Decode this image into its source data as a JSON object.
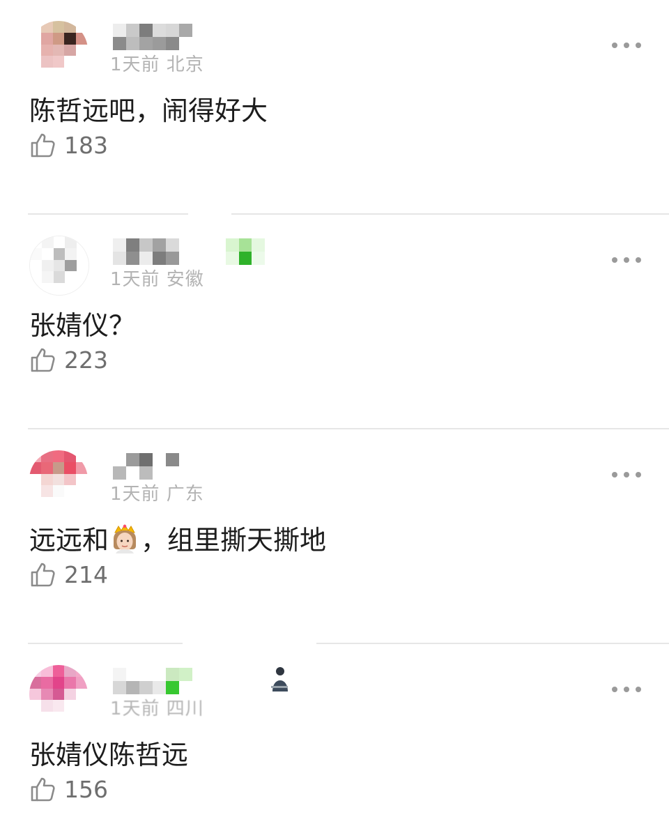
{
  "comments": [
    {
      "meta": "1天前 北京",
      "text": "陈哲远吧，闹得好大",
      "likes": "183",
      "avatar_colors": [
        "#fff",
        "#e7c9b6",
        "#d6c19f",
        "#d2b79c",
        "#fff",
        "#fff",
        "#e0a6a2",
        "#cf9a85",
        "#3a2520",
        "#d49187",
        "#fff",
        "#e6b2ae",
        "#e3b8b4",
        "#d6a6a4",
        "#fff",
        "#fff",
        "#ecc3c3",
        "#f0c8c8",
        "#fff",
        "#fff",
        "#fff",
        "#fff",
        "#fff",
        "#fff",
        "#fff"
      ],
      "name_colors": [
        "#ededed",
        "#8b8b8b",
        "#c9c9c9",
        "#bdbdbd",
        "#7d7d7d",
        "#a3a3a3",
        "#dcdcdc",
        "#9b9b9b",
        "#d7d7d7",
        "#8a8a8a",
        "#a9a9a9"
      ]
    },
    {
      "meta": "1天前 安徽",
      "text": "张婧仪？",
      "likes": "223",
      "avatar_colors": [
        "#fff",
        "#f4f4f4",
        "#ffffff",
        "#eeeeee",
        "#fff",
        "#fafafa",
        "#ffffff",
        "#bdbdbd",
        "#f3f3f3",
        "#fff",
        "#fff",
        "#f0f0f0",
        "#e6e6e6",
        "#9e9e9e",
        "#fff",
        "#fff",
        "#f5f5f5",
        "#dadada",
        "#fff",
        "#fff",
        "#fff",
        "#fff",
        "#fff",
        "#fff",
        "#fff"
      ],
      "name_colors": [
        "#efefef",
        "#e4e4e4",
        "#7f7f7f",
        "#8f8f8f",
        "#c7c7c7",
        "#ececec",
        "#a2a2a2",
        "#7d7d7d",
        "#dadada",
        "#999999",
        "#ffffff"
      ]
    },
    {
      "meta": "1天前 广东",
      "text_before": "远远和",
      "text_after": "，组里撕天撕地",
      "likes": "214",
      "avatar_colors": [
        "#f4a8b3",
        "#e86f83",
        "#f06b80",
        "#e45770",
        "#fff",
        "#e35a70",
        "#e96878",
        "#c79a8a",
        "#ea4e65",
        "#f09aa8",
        "#fff",
        "#f4d6d3",
        "#f2e0de",
        "#f3c5c8",
        "#fff",
        "#fff",
        "#f7e4e4",
        "#fafafa",
        "#fff",
        "#fff",
        "#fff",
        "#fff",
        "#fff",
        "#fff",
        "#fff"
      ],
      "name_colors": [
        "#ffffff",
        "#b8b8b8",
        "#9b9b9b",
        "#ffffff",
        "#6f6f6f",
        "#bcbcbc",
        "#ffffff",
        "#ffffff",
        "#8a8a8a",
        "#ffffff",
        "#ffffff"
      ]
    },
    {
      "meta": "1天前 四川",
      "text": "张婧仪陈哲远",
      "likes": "156",
      "avatar_colors": [
        "#f7cce3",
        "#f8bdd8",
        "#ee5f99",
        "#e8a7c6",
        "#f3a8c8",
        "#d86e9c",
        "#e96ba2",
        "#e2448a",
        "#ea77aa",
        "#f0a0c3",
        "#f6c7dc",
        "#e789b4",
        "#d55a93",
        "#f4d2e2",
        "#fff",
        "#fff",
        "#f6e0ea",
        "#f9e8ef",
        "#fff",
        "#fff",
        "#fff",
        "#fff",
        "#fff",
        "#fff",
        "#fff"
      ],
      "name_colors": [
        "#f4f4f4",
        "#d7d7d7",
        "#ffffff",
        "#b5b5b5",
        "#ffffff",
        "#cfcfcf",
        "#ffffff",
        "#e9e9e9",
        "#cbe9c0",
        "#37c830",
        "#d1f1c7"
      ]
    }
  ],
  "colors": {
    "divider": "#e6e6e6",
    "like_count": "#6e6e6e",
    "meta": "#b3b3b3",
    "text": "#1c1c1c"
  },
  "icons": {
    "like": "thumbs-up-icon",
    "more": "more-dots-icon",
    "emoji": "princess-crown-emoji",
    "badge": "man-laptop-icon"
  }
}
